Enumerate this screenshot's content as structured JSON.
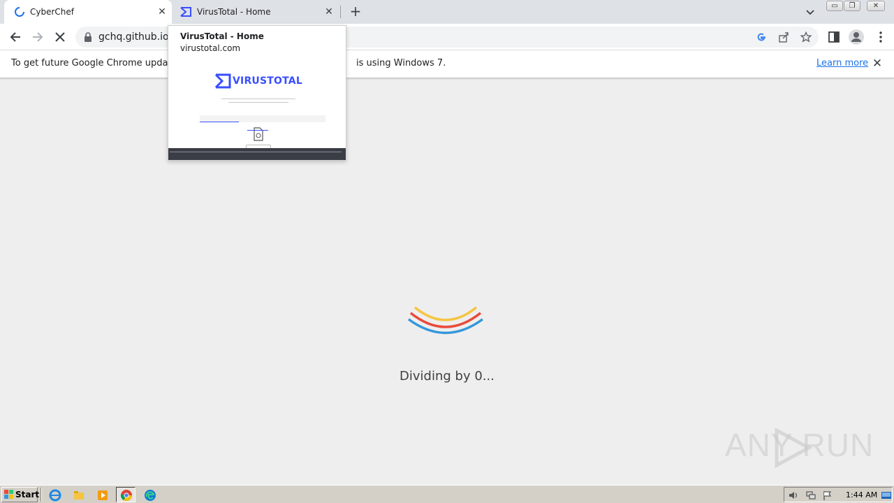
{
  "browser": {
    "tabs": [
      {
        "title": "CyberChef",
        "favicon": "loading-spinner-icon",
        "active": true
      },
      {
        "title": "VirusTotal - Home",
        "favicon": "virustotal-icon",
        "active": false
      }
    ],
    "address": {
      "url": "gchq.github.io/C"
    },
    "window_buttons": {
      "minimize": "▭",
      "restore": "❐",
      "close": "✕"
    }
  },
  "infobar": {
    "message": "To get future Google Chrome updates, y",
    "message_tail": "is using Windows 7.",
    "learn_more": "Learn more",
    "close": "✕"
  },
  "hover_card": {
    "title": "VirusTotal - Home",
    "domain": "virustotal.com",
    "preview_brand": "VIRUSTOTAL"
  },
  "page": {
    "loading_text": "Dividing by 0...",
    "loader_colors": [
      "#f4c542",
      "#e74c3c",
      "#3498db"
    ]
  },
  "watermark": {
    "text": "ANY RUN"
  },
  "taskbar": {
    "start_label": "Start",
    "clock": "1:44 AM"
  }
}
